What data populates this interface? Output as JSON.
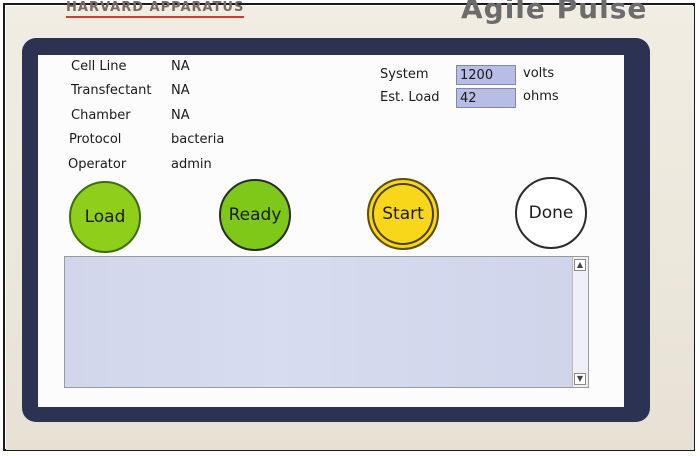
{
  "brand": {
    "left_text": "HARVARD APPARATUS",
    "right_text": "Agile Pulse"
  },
  "info": [
    {
      "label": "Cell Line",
      "value": "NA"
    },
    {
      "label": "Transfectant",
      "value": "NA"
    },
    {
      "label": "Chamber",
      "value": "NA"
    },
    {
      "label": "Protocol",
      "value": "bacteria"
    },
    {
      "label": "Operator",
      "value": "admin"
    }
  ],
  "system": {
    "label": "System",
    "value": "1200",
    "unit": "volts"
  },
  "load": {
    "label": "Est. Load",
    "value": "42",
    "unit": "ohms"
  },
  "buttons": {
    "load": "Load",
    "ready": "Ready",
    "start": "Start",
    "done": "Done"
  },
  "colors": {
    "load": "#8fce1a",
    "ready": "#7ec81a",
    "start": "#f8d61a",
    "done": "#ffffff",
    "bezel": "#2c3352",
    "field": "#b8bde6"
  },
  "icons": {
    "scroll_up": "scroll-up-arrow-icon",
    "scroll_down": "scroll-down-arrow-icon"
  }
}
